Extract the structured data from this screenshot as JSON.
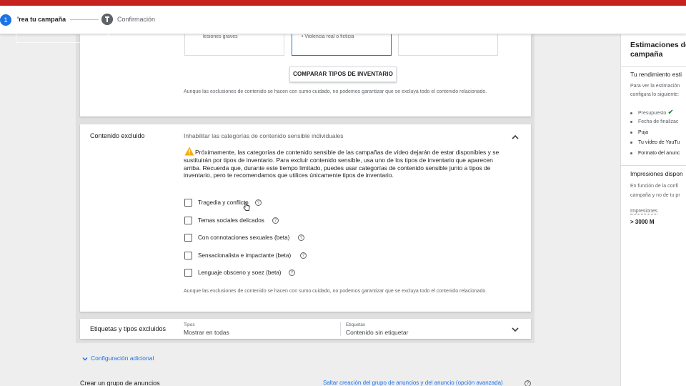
{
  "stepper": {
    "step1_number": "1",
    "step1_label": "'rea tu campaña",
    "step2_label": "Confirmación"
  },
  "inventory": {
    "boxes": [
      {
        "text": "lesiones graves"
      },
      {
        "text": "• Violencia real o ficticia"
      },
      {
        "text": ""
      }
    ],
    "compare_button": "COMPARAR TIPOS DE INVENTARIO",
    "disclaimer": "Aunque las exclusiones de contenido se hacen con sumo cuidado, no podemos garantizar que se excluya todo el contenido relacionado."
  },
  "excluded": {
    "title": "Contenido excluido",
    "subtitle": "Inhabilitar las categorías de contenido sensible individuales",
    "warning": "Próximamente, las categorías de contenido sensible de las campañas de vídeo dejarán de estar disponibles y se sustituirán por tipos de inventario. Para excluir contenido sensible, usa uno de los tipos de inventario que aparecen arriba. Recuerda que, durante este tiempo limitado, puedes usar categorías de contenido sensible junto a tipos de inventario, pero te recomendamos que utilices únicamente tipos de inventario.",
    "options": [
      {
        "label": "Tragedia y conflicto",
        "checked": false
      },
      {
        "label": "Temas sociales delicados",
        "checked": false
      },
      {
        "label": "Con connotaciones sexuales (beta)",
        "checked": false
      },
      {
        "label": "Sensacionalista e impactante (beta)",
        "checked": false
      },
      {
        "label": "Lenguaje obsceno y soez (beta)",
        "checked": false
      }
    ],
    "help_glyph": "?",
    "disclaimer": "Aunque las exclusiones de contenido se hacen con sumo cuidado, no podemos garantizar que se excluya todo el contenido relacionado."
  },
  "labels": {
    "title": "Etiquetas y tipos excluidos",
    "types_caption": "Tipos",
    "types_value": "Mostrar en todas",
    "labels_caption": "Etiquetas",
    "labels_value": "Contenido sin etiquetar"
  },
  "additional_config": "Configuración adicional",
  "ad_group": {
    "title": "Crear un grupo de anuncios",
    "skip_link": "Saltar creación del grupo de anuncios y del anuncio (opción avanzada)"
  },
  "estimates": {
    "title": "Estimaciones de campaña",
    "performance_title": "Tu rendimiento esti",
    "intro_line1": "Para ver la estimación",
    "intro_line2": "configura lo siguiente:",
    "items": [
      {
        "label": "Presupuesto",
        "done": true
      },
      {
        "label": "Fecha de finalizac",
        "done": false
      },
      {
        "label": "Puja",
        "done": false
      },
      {
        "label": "Tu vídeo de YouTu",
        "done": false
      },
      {
        "label": "Formato del anunc",
        "done": false
      }
    ],
    "check_glyph": "✔",
    "impressions_title": "Impresiones dispon",
    "impressions_desc_line1": "En función de la confi",
    "impressions_desc_line2": "campaña y no de tu pr",
    "impressions_label": "Impresiones",
    "impressions_value": "> 3000 M"
  },
  "colors": {
    "brand_red": "#c5221f",
    "accent_blue": "#1a73e8",
    "warning_yellow": "#f9ab00",
    "success_green": "#188038"
  }
}
